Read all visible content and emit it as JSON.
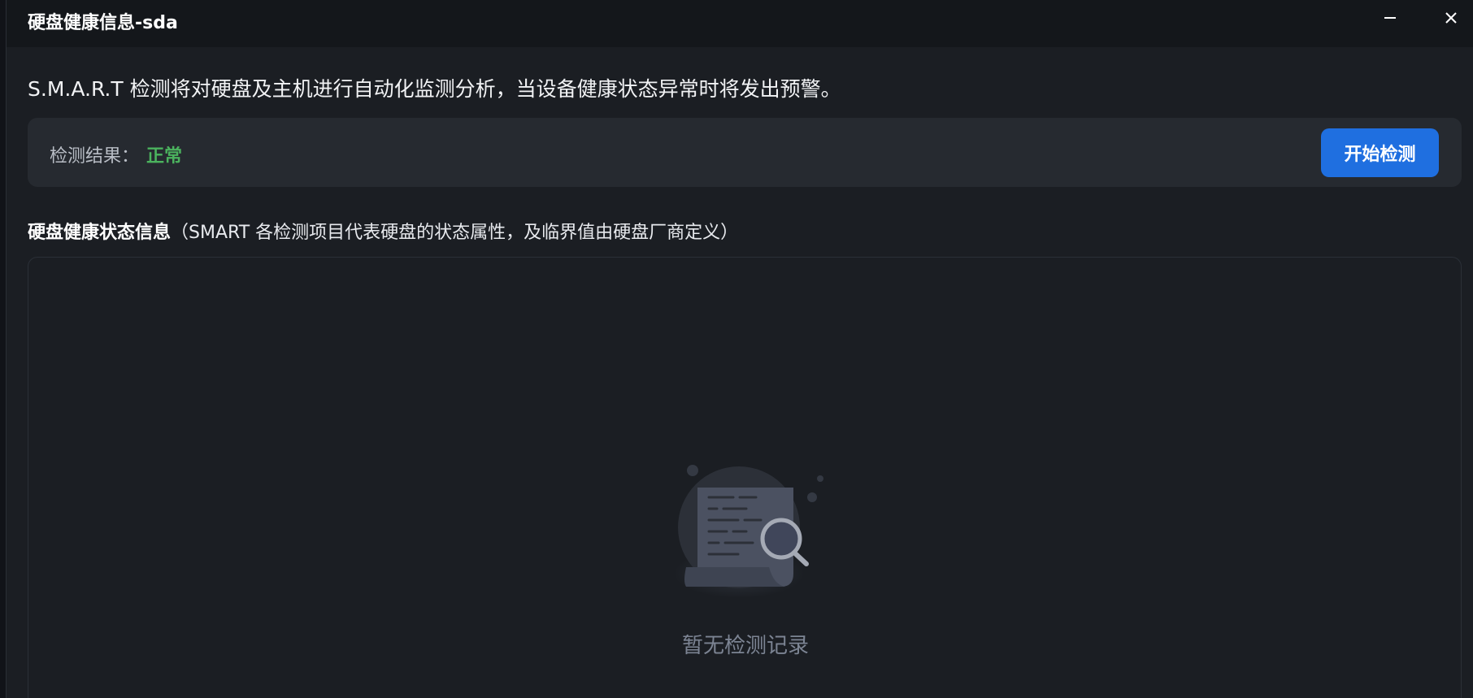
{
  "window": {
    "title": "硬盘健康信息-sda"
  },
  "description": "S.M.A.R.T 检测将对硬盘及主机进行自动化监测分析，当设备健康状态异常时将发出预警。",
  "result": {
    "label": "检测结果：",
    "value": "正常",
    "value_color": "#4bb35e"
  },
  "start_button": {
    "label": "开始检测",
    "color": "#1f6fe0"
  },
  "section": {
    "title": "硬盘健康状态信息",
    "note": "（SMART 各检测项目代表硬盘的状态属性，及临界值由硬盘厂商定义）"
  },
  "empty_state": {
    "icon": "empty-search-document-icon",
    "text": "暂无检测记录"
  },
  "icons": {
    "minimize": "minimize-icon",
    "close": "close-icon"
  }
}
